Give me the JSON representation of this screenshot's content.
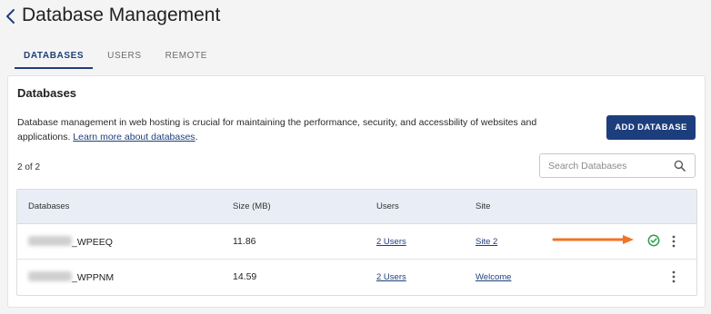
{
  "header": {
    "title": "Database Management",
    "back_icon": "chevron-left-icon"
  },
  "tabs": [
    {
      "label": "DATABASES",
      "active": true
    },
    {
      "label": "USERS",
      "active": false
    },
    {
      "label": "REMOTE",
      "active": false
    }
  ],
  "card": {
    "title": "Databases",
    "description": "Database management in web hosting is crucial for maintaining the performance, security, and accessbility of websites and applications.",
    "learn_more_link": "Learn more about databases",
    "description_suffix": ".",
    "add_button_label": "ADD DATABASE",
    "count_text": "2 of 2",
    "search_placeholder": "Search Databases"
  },
  "table": {
    "columns": [
      "Databases",
      "Size (MB)",
      "Users",
      "Site"
    ],
    "rows": [
      {
        "database": "_WPEEQ",
        "size": "11.86",
        "users": "2 Users",
        "site": "Site 2",
        "status_icon": "check-circle-icon"
      },
      {
        "database": "_WPPNM",
        "size": "14.59",
        "users": "2 Users",
        "site": "Welcome"
      }
    ]
  },
  "colors": {
    "primary": "#1d3e7d",
    "accent_arrow": "#f07424",
    "success": "#2e9e4a",
    "table_header_bg": "#e9eef6"
  }
}
